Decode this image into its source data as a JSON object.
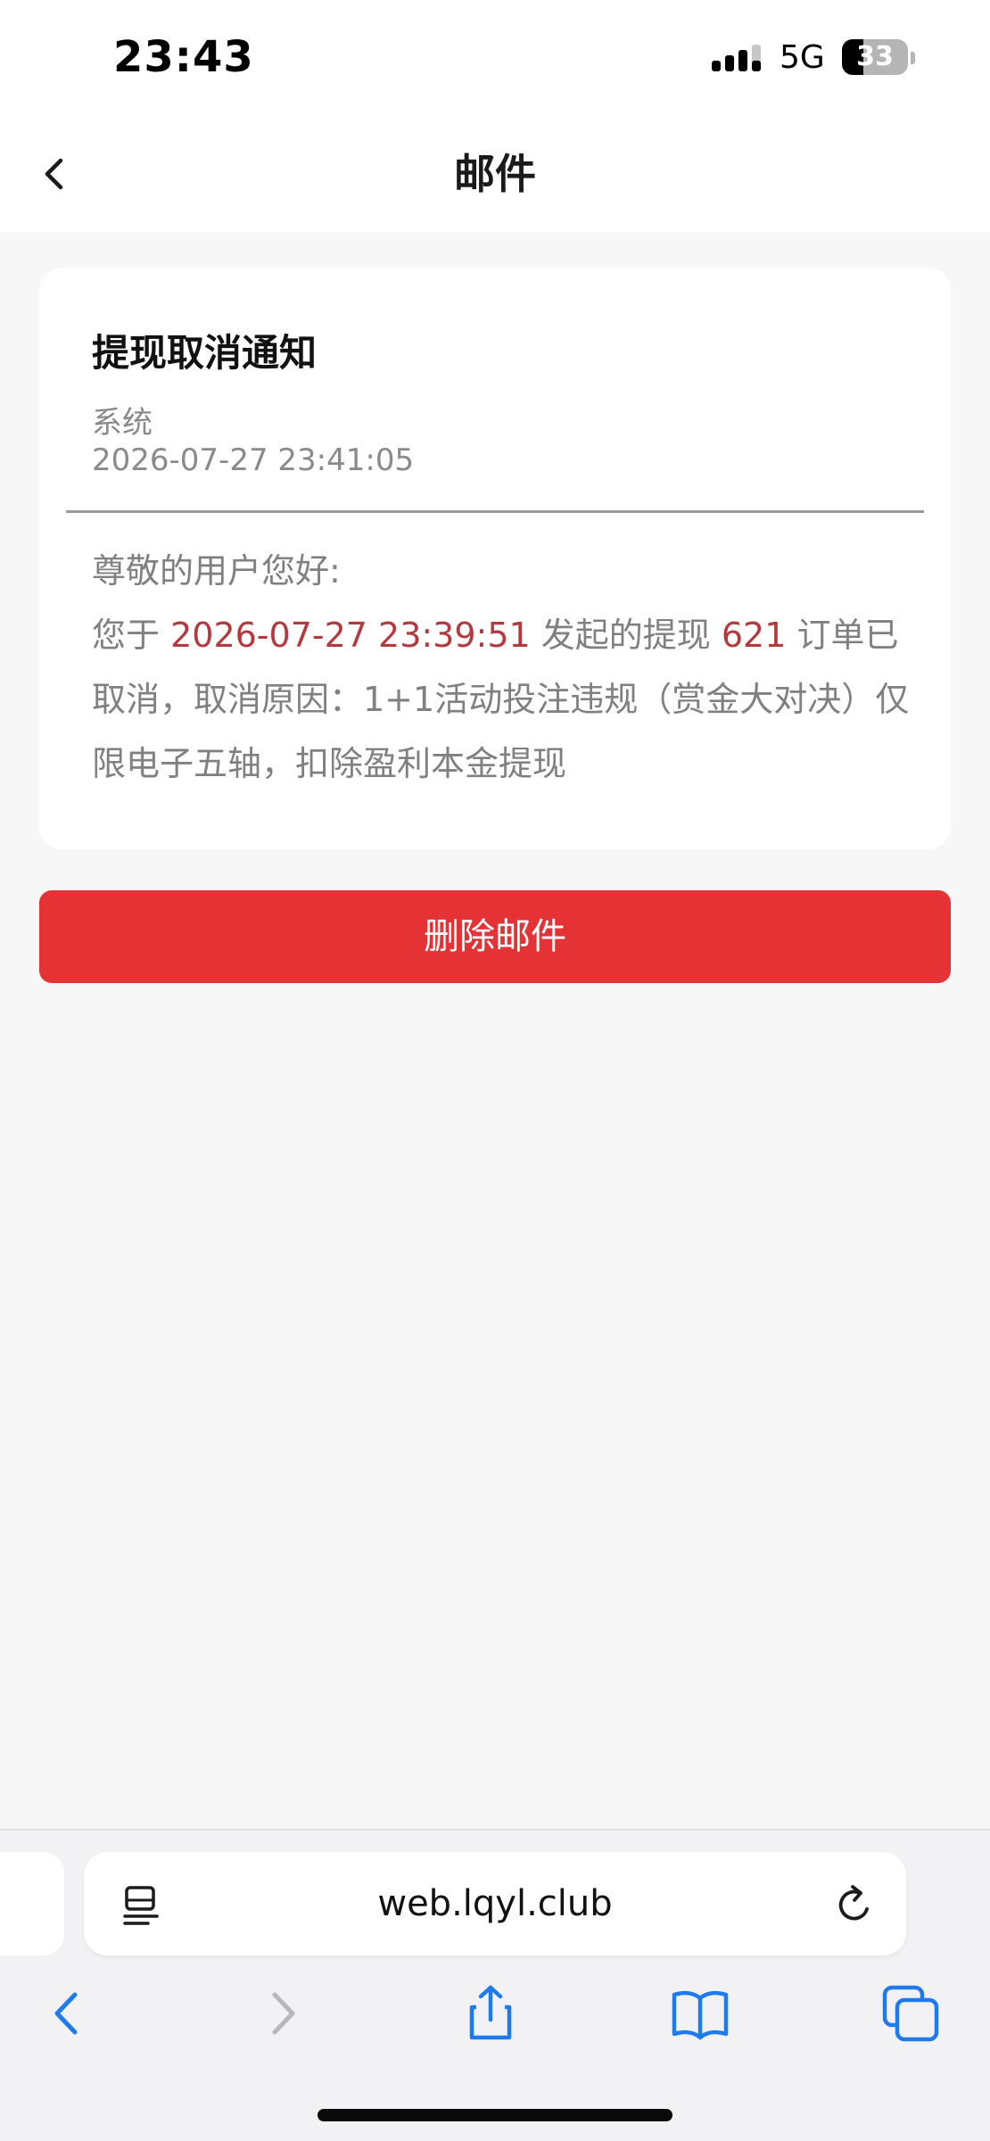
{
  "status_bar": {
    "time": "23:43",
    "network": "5G",
    "battery": "33",
    "battery_level_percent": 33
  },
  "header": {
    "title": "邮件"
  },
  "mail": {
    "title": "提现取消通知",
    "sender": "系统",
    "time": "2026-07-27 23:41:05",
    "greeting": "尊敬的用户您好:",
    "body_prefix": "您于 ",
    "order_time": "2026-07-27 23:39:51",
    "body_mid": " 发起的提现 ",
    "amount": "621",
    "body_suffix": " 订单已取消，取消原因：1+1活动投注违规（赏金大对决）仅限电子五轴，扣除盈利本金提现"
  },
  "actions": {
    "delete_label": "删除邮件"
  },
  "browser": {
    "url": "web.lqyl.club"
  },
  "colors": {
    "accent_red": "#e53235",
    "highlight_text": "#b23a3f",
    "ios_blue": "#1f7aec"
  }
}
